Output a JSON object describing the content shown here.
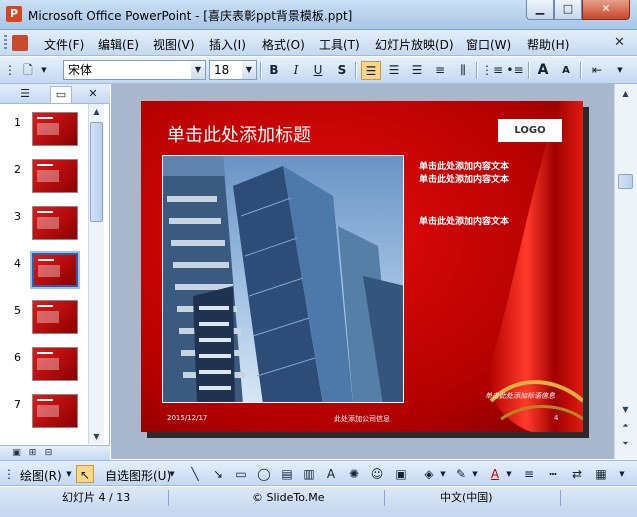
{
  "window": {
    "title": "Microsoft Office PowerPoint - [喜庆表彰ppt背景模板.ppt]",
    "app_icon": "P",
    "minimize_glyph": "▁",
    "maximize_glyph": "□",
    "close_glyph": "✕"
  },
  "menubar": {
    "items": [
      "文件(F)",
      "编辑(E)",
      "视图(V)",
      "插入(I)",
      "格式(O)",
      "工具(T)",
      "幻灯片放映(D)",
      "窗口(W)",
      "帮助(H)"
    ],
    "close_doc_glyph": "✕"
  },
  "toolbar": {
    "font_name": "宋体",
    "font_size": "18",
    "bold": "B",
    "italic": "I",
    "underline": "U",
    "shadow": "S",
    "align_left_active": true,
    "font_grow": "A",
    "font_shrink": "A"
  },
  "left_pane": {
    "tab_outline_icon": "outline-icon",
    "tab_slides_icon": "slides-icon",
    "close_glyph": "✕",
    "slides": [
      {
        "num": "1"
      },
      {
        "num": "2"
      },
      {
        "num": "3"
      },
      {
        "num": "4",
        "selected": true
      },
      {
        "num": "5"
      },
      {
        "num": "6"
      },
      {
        "num": "7"
      }
    ]
  },
  "slide": {
    "title": "单击此处添加标题",
    "logo": "LOGO",
    "body_lines": [
      "单击此处添加内容文本",
      "单击此处添加内容文本",
      "单击此处添加内容文本"
    ],
    "date": "2015/12/17",
    "company": "此处添加公司信息",
    "slogan": "单击此处添加标语信息",
    "page_num": "4"
  },
  "drawbar": {
    "draw_label": "绘图(R)",
    "autoshapes_label": "自选图形(U)"
  },
  "statusbar": {
    "slide_info": "幻灯片 4 / 13",
    "design": "© SlideTo.Me",
    "language": "中文(中国)"
  },
  "colors": {
    "slide_red": "#d40000",
    "selection_blue": "#2f5fa8",
    "chrome_blue": "#c5d9f1"
  }
}
